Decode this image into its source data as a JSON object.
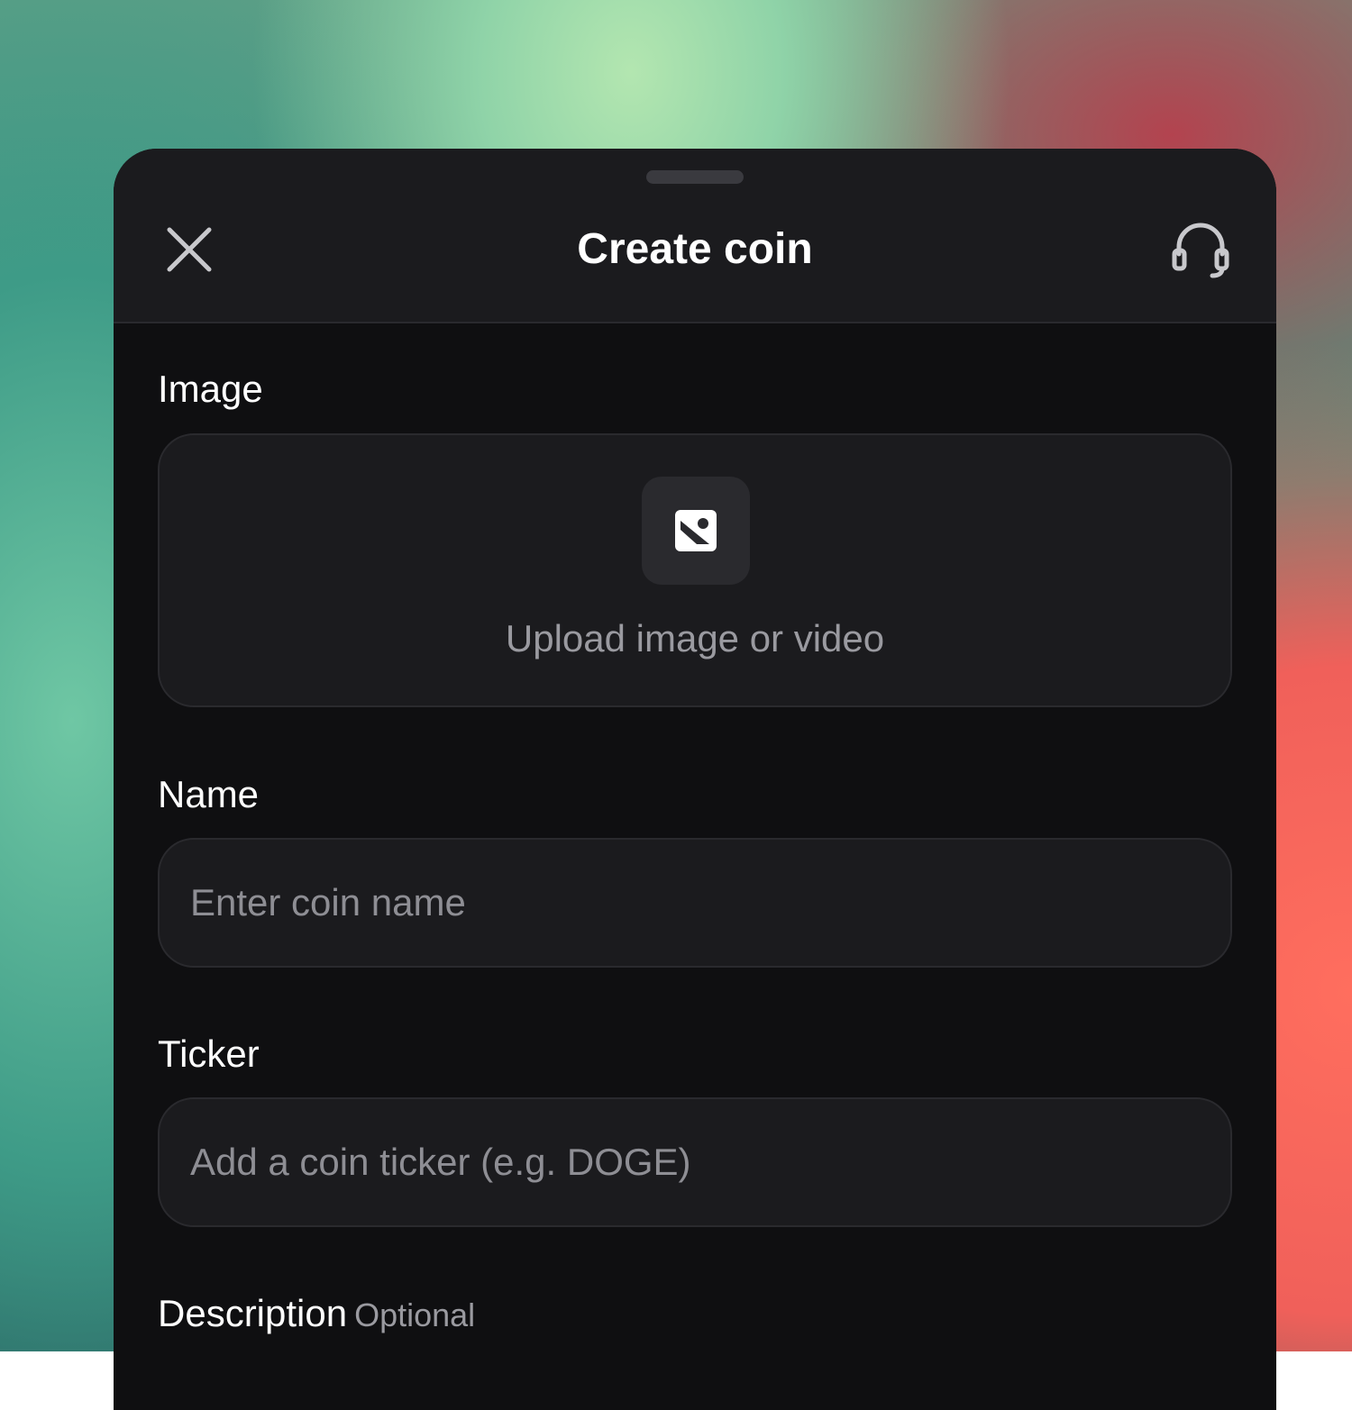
{
  "header": {
    "title": "Create coin",
    "close_icon": "close-icon",
    "support_icon": "headset-icon"
  },
  "image_section": {
    "label": "Image",
    "upload_text": "Upload image or video",
    "upload_icon": "image-icon"
  },
  "name_section": {
    "label": "Name",
    "placeholder": "Enter coin name",
    "value": ""
  },
  "ticker_section": {
    "label": "Ticker",
    "placeholder": "Add a coin ticker (e.g. DOGE)",
    "value": ""
  },
  "description_section": {
    "label": "Description",
    "optional_tag": "Optional"
  },
  "colors": {
    "sheet_background": "#0f0f11",
    "surface": "#1b1b1e",
    "border": "#2a2a2e",
    "text_primary": "#ffffff",
    "text_muted": "#9a9aa0"
  }
}
